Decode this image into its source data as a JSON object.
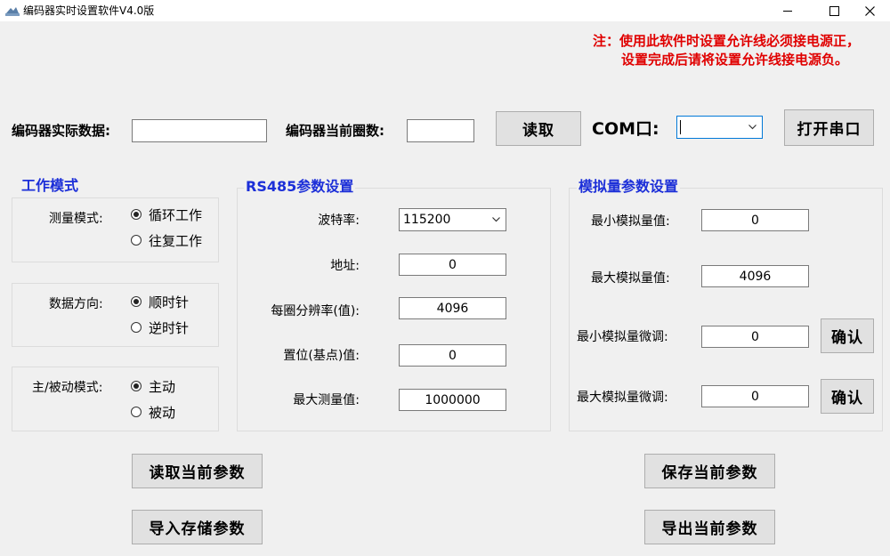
{
  "window": {
    "title": "编码器实时设置软件V4.0版",
    "minimize_glyph": "—",
    "close_glyph": "✕"
  },
  "notice": {
    "line1": "注：使用此软件时设置允许线必须接电源正，",
    "line2": "设置完成后请将设置允许线接电源负。"
  },
  "top": {
    "actual_data_label": "编码器实际数据:",
    "actual_data_value": "",
    "circle_count_label": "编码器当前圈数:",
    "circle_count_value": "",
    "read_button": "读取",
    "com_label": "COM口:",
    "com_value": "",
    "open_port_button": "打开串口"
  },
  "work_mode": {
    "title": "工作模式",
    "measure": {
      "label": "测量模式:",
      "options": [
        "循环工作",
        "往复工作"
      ],
      "selected": 0
    },
    "direction": {
      "label": "数据方向:",
      "options": [
        "顺时针",
        "逆时针"
      ],
      "selected": 0
    },
    "active": {
      "label": "主/被动模式:",
      "options": [
        "主动",
        "被动"
      ],
      "selected": 0
    }
  },
  "rs485": {
    "title": "RS485参数设置",
    "baud_label": "波特率:",
    "baud_value": "115200",
    "address_label": "地址:",
    "address_value": "0",
    "resolution_label": "每圈分辨率(值):",
    "resolution_value": "4096",
    "reset_label": "置位(基点)值:",
    "reset_value": "0",
    "max_label": "最大测量值:",
    "max_value": "1000000"
  },
  "analog": {
    "title": "模拟量参数设置",
    "min_label": "最小模拟量值:",
    "min_value": "0",
    "max_label": "最大模拟量值:",
    "max_value": "4096",
    "min_trim_label": "最小模拟量微调:",
    "min_trim_value": "0",
    "max_trim_label": "最大模拟量微调:",
    "max_trim_value": "0",
    "confirm_button": "确认"
  },
  "actions": {
    "read_params": "读取当前参数",
    "import_params": "导入存储参数",
    "save_params": "保存当前参数",
    "export_params": "导出当前参数"
  },
  "colors": {
    "notice": "#e00000",
    "group_title": "#1c2fd8",
    "client_bg": "#f0f0f0",
    "button_bg": "#e1e1e1"
  }
}
